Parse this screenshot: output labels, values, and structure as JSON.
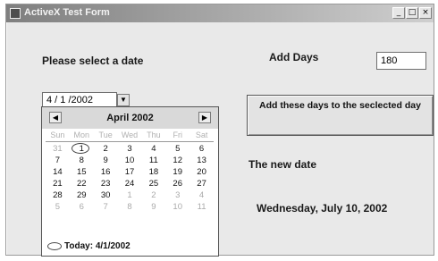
{
  "window": {
    "title": "ActiveX Test Form",
    "controls": {
      "minimize": "_",
      "maximize": "□",
      "close": "×"
    }
  },
  "labels": {
    "select_date": "Please select a date",
    "add_days": "Add Days",
    "new_date": "The new date"
  },
  "add_days_input": {
    "value": "180"
  },
  "date_picker": {
    "value": "4 / 1 /2002",
    "dropdown_glyph": "▼"
  },
  "add_button": {
    "label": "Add these days to the seclected day"
  },
  "result": {
    "value": "Wednesday, July 10, 2002"
  },
  "calendar": {
    "month_label": "April 2002",
    "prev_glyph": "◀",
    "next_glyph": "▶",
    "weekdays": [
      "Sun",
      "Mon",
      "Tue",
      "Wed",
      "Thu",
      "Fri",
      "Sat"
    ],
    "days": [
      "31",
      "1",
      "2",
      "3",
      "4",
      "5",
      "6",
      "7",
      "8",
      "9",
      "10",
      "11",
      "12",
      "13",
      "14",
      "15",
      "16",
      "17",
      "18",
      "19",
      "20",
      "21",
      "22",
      "23",
      "24",
      "25",
      "26",
      "27",
      "28",
      "29",
      "30",
      "1",
      "2",
      "3",
      "4",
      "5",
      "6",
      "7",
      "8",
      "9",
      "10",
      "11"
    ],
    "today_label": "Today: 4/1/2002"
  }
}
